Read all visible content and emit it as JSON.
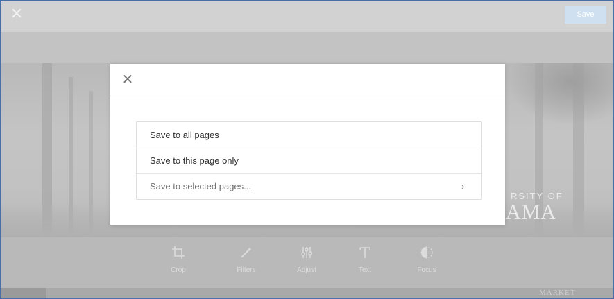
{
  "topbar": {
    "close_icon": "close-icon",
    "save_label": "Save"
  },
  "background": {
    "brand_line1": "RSITY OF",
    "brand_line2": "AMA",
    "strip_text": "MARKET"
  },
  "tools": [
    {
      "label": "Crop",
      "icon": "crop-icon"
    },
    {
      "label": "Filters",
      "icon": "filters-icon"
    },
    {
      "label": "Adjust",
      "icon": "adjust-icon"
    },
    {
      "label": "Text",
      "icon": "text-icon"
    },
    {
      "label": "Focus",
      "icon": "focus-icon"
    }
  ],
  "modal": {
    "close_icon": "close-icon",
    "options": [
      {
        "label": "Save to all pages"
      },
      {
        "label": "Save to this page only"
      },
      {
        "label": "Save to selected pages...",
        "chevron_icon": "chevron-right-icon"
      }
    ]
  }
}
